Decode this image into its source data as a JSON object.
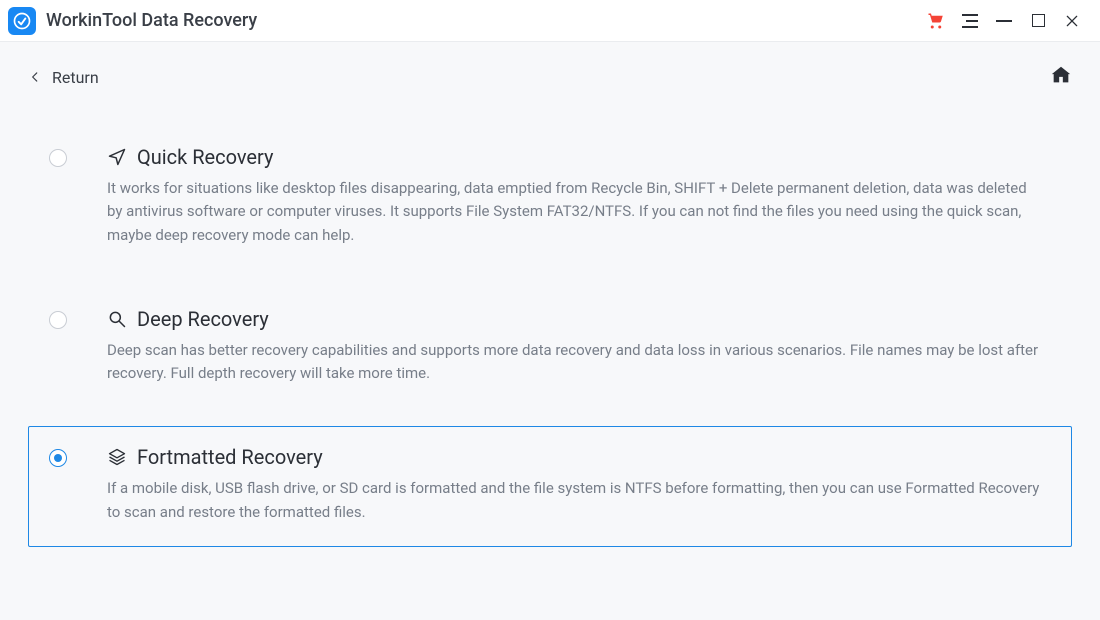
{
  "titlebar": {
    "app_title": "WorkinTool Data Recovery"
  },
  "nav": {
    "return_label": "Return"
  },
  "options": [
    {
      "id": "quick",
      "title": "Quick Recovery",
      "description": "It works for situations like desktop files disappearing, data emptied from Recycle Bin, SHIFT + Delete permanent deletion, data was deleted by antivirus software or computer viruses. It supports File System FAT32/NTFS. If you can not find the files you need using the quick scan, maybe deep recovery mode can help.",
      "selected": false
    },
    {
      "id": "deep",
      "title": "Deep Recovery",
      "description": "Deep scan has better recovery capabilities and supports more data recovery and data loss in various scenarios. File names may be lost after recovery. Full depth recovery will take more time.",
      "selected": false
    },
    {
      "id": "formatted",
      "title": "Fortmatted Recovery",
      "description": "If a mobile disk, USB flash drive, or SD card is formatted and the file system is NTFS before formatting, then you can use Formatted Recovery to scan and restore the formatted files.",
      "selected": true
    }
  ]
}
